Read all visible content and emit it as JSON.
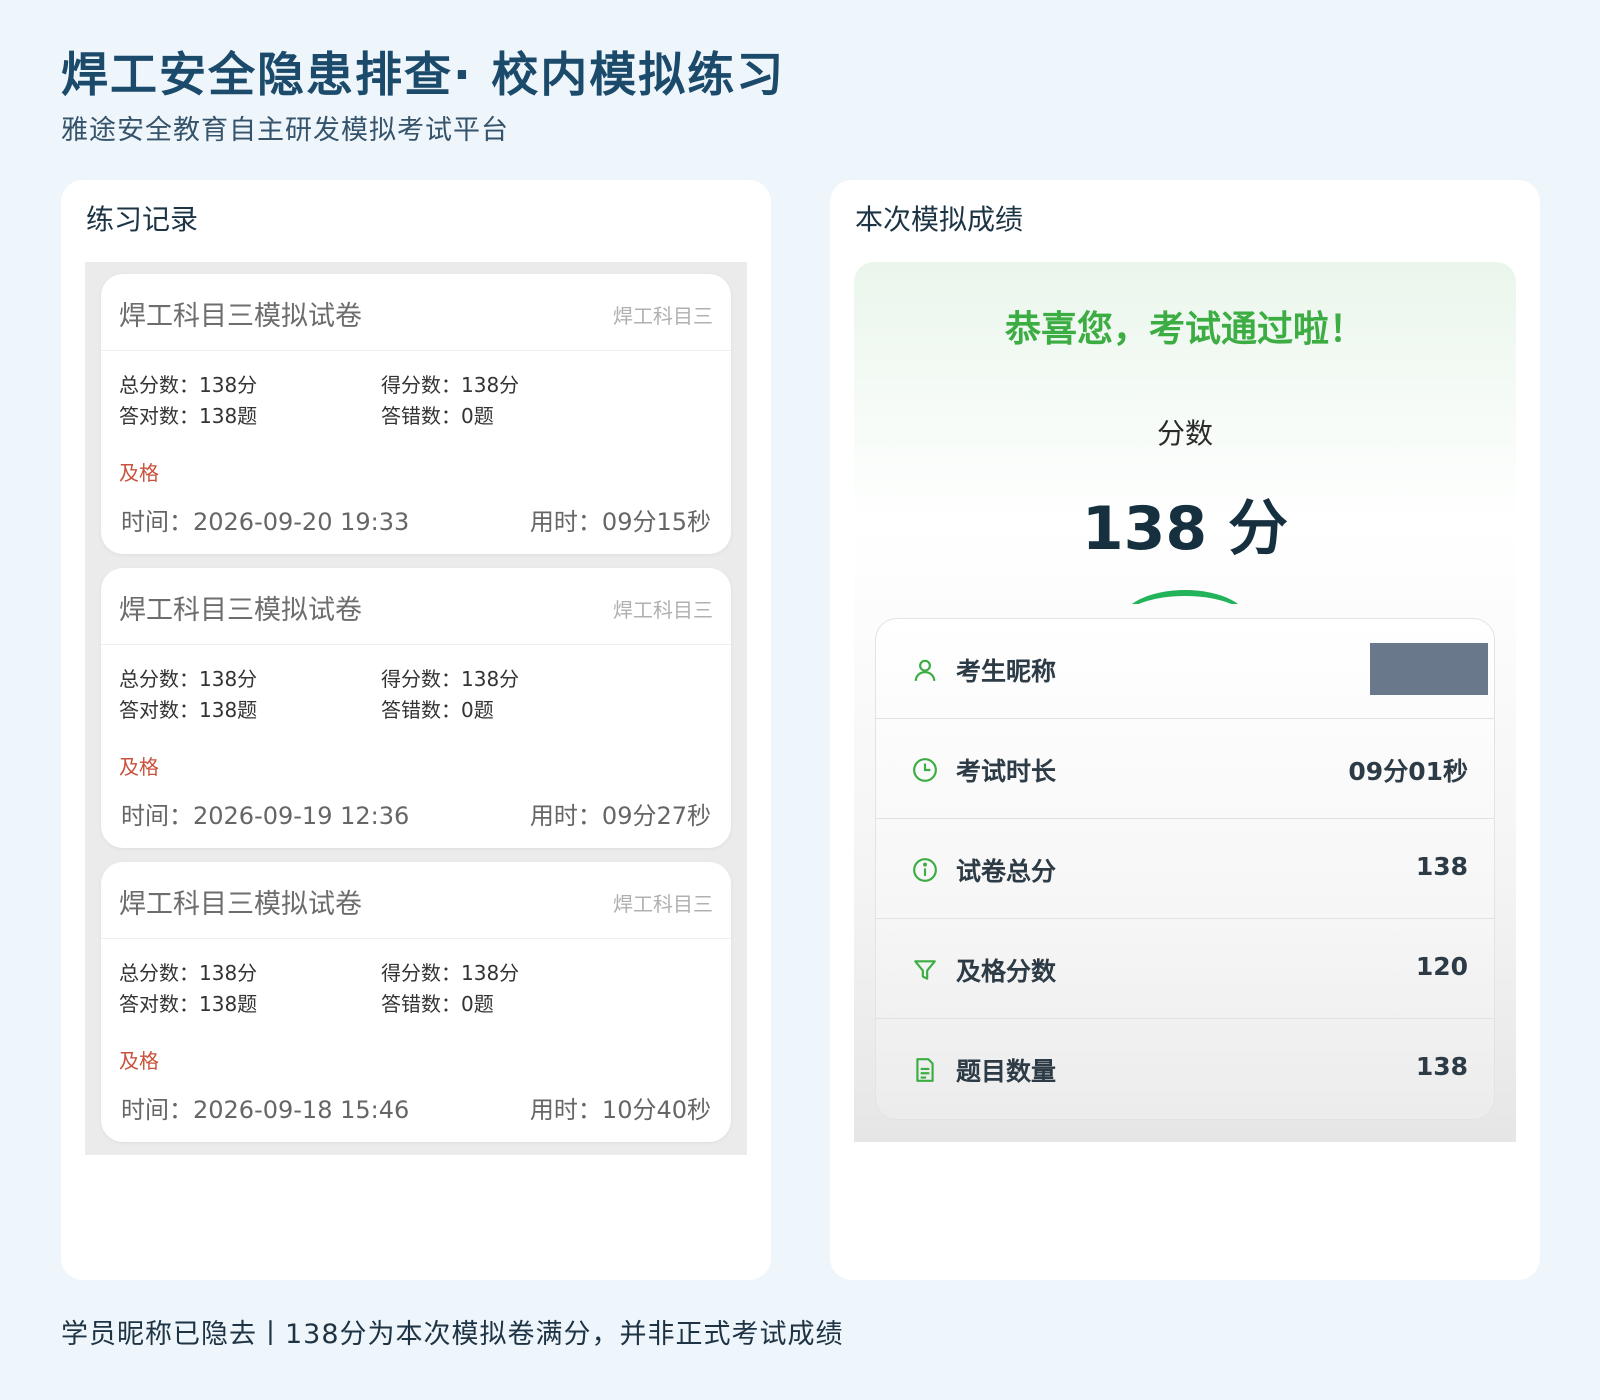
{
  "header": {
    "title": "焊工安全隐患排查· 校内模拟练习",
    "subtitle": "雅途安全教育自主研发模拟考试平台"
  },
  "records_panel": {
    "title": "练习记录",
    "records": [
      {
        "paper_title": "焊工科目三模拟试卷",
        "tag": "焊工科目三",
        "total_score": "总分数：138分",
        "obtained_score": "得分数：138分",
        "correct": "答对数：138题",
        "wrong": "答错数：0题",
        "status": "及格",
        "time": "时间：2026-09-20 19:33",
        "duration": "用时：09分15秒"
      },
      {
        "paper_title": "焊工科目三模拟试卷",
        "tag": "焊工科目三",
        "total_score": "总分数：138分",
        "obtained_score": "得分数：138分",
        "correct": "答对数：138题",
        "wrong": "答错数：0题",
        "status": "及格",
        "time": "时间：2026-09-19 12:36",
        "duration": "用时：09分27秒"
      },
      {
        "paper_title": "焊工科目三模拟试卷",
        "tag": "焊工科目三",
        "total_score": "总分数：138分",
        "obtained_score": "得分数：138分",
        "correct": "答对数：138题",
        "wrong": "答错数：0题",
        "status": "及格",
        "time": "时间：2026-09-18 15:46",
        "duration": "用时：10分40秒"
      }
    ]
  },
  "result_panel": {
    "title": "本次模拟成绩",
    "congrats": "恭喜您，考试通过啦！",
    "score_label": "分数",
    "score_value": "138 分",
    "accent_color": "#3cad43",
    "rows": [
      {
        "icon": "user-icon",
        "label": "考生昵称",
        "value": ""
      },
      {
        "icon": "clock-icon",
        "label": "考试时长",
        "value": "09分01秒"
      },
      {
        "icon": "info-icon",
        "label": "试卷总分",
        "value": "138"
      },
      {
        "icon": "filter-icon",
        "label": "及格分数",
        "value": "120"
      },
      {
        "icon": "document-icon",
        "label": "题目数量",
        "value": "138"
      }
    ]
  },
  "footer": {
    "note": "学员昵称已隐去丨138分为本次模拟卷满分，并非正式考试成绩"
  }
}
